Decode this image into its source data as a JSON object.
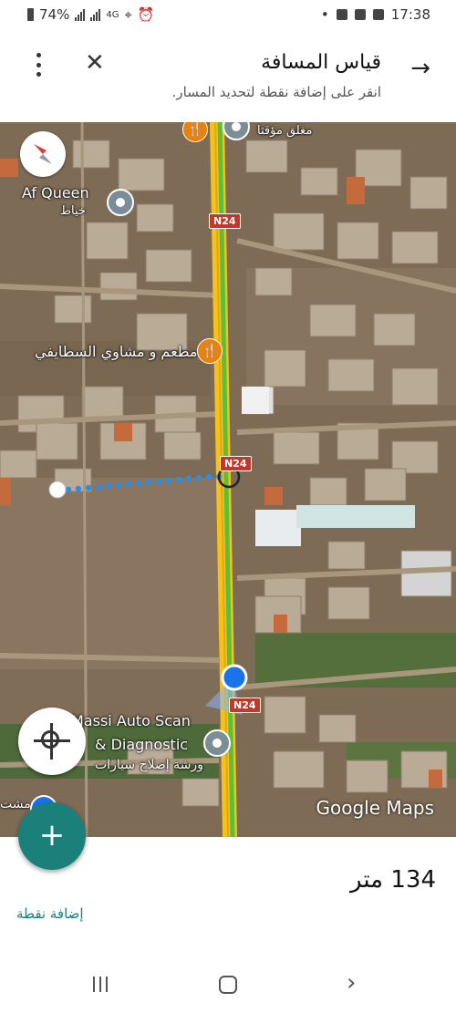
{
  "status_bar": {
    "battery": "74%",
    "network": "4G",
    "time": "17:38"
  },
  "header": {
    "title": "قياس المسافة",
    "subtitle": "انقر على إضافة نقطة لتحديد المسار.",
    "back_icon": "arrow-back-icon",
    "close_icon": "close-icon",
    "menu_icon": "more-vert-icon"
  },
  "map": {
    "labels": {
      "af_queen": "Af Queen",
      "khayat": "خياط",
      "closed_temp": "مغلق مؤقتا",
      "restaurant": "مطعم و مشاوي السطايفي",
      "massi_line1": "Massi Auto Scan",
      "massi_line2": "& Diagnostic",
      "massi_line3": "ورشة إصلاح سيارات",
      "partial": "مشت"
    },
    "road_shields": [
      "N24",
      "N24",
      "N24"
    ],
    "attribution": "Google Maps",
    "colors": {
      "route_green": "#5bbf3a",
      "route_yellow": "#f4c21b",
      "measure_dots": "#2a8ee8",
      "location_dot": "#1a73e8"
    }
  },
  "buttons": {
    "add_fab": "+",
    "add_point": "إضافة نقطة"
  },
  "measurement": {
    "distance": "134 متر"
  }
}
